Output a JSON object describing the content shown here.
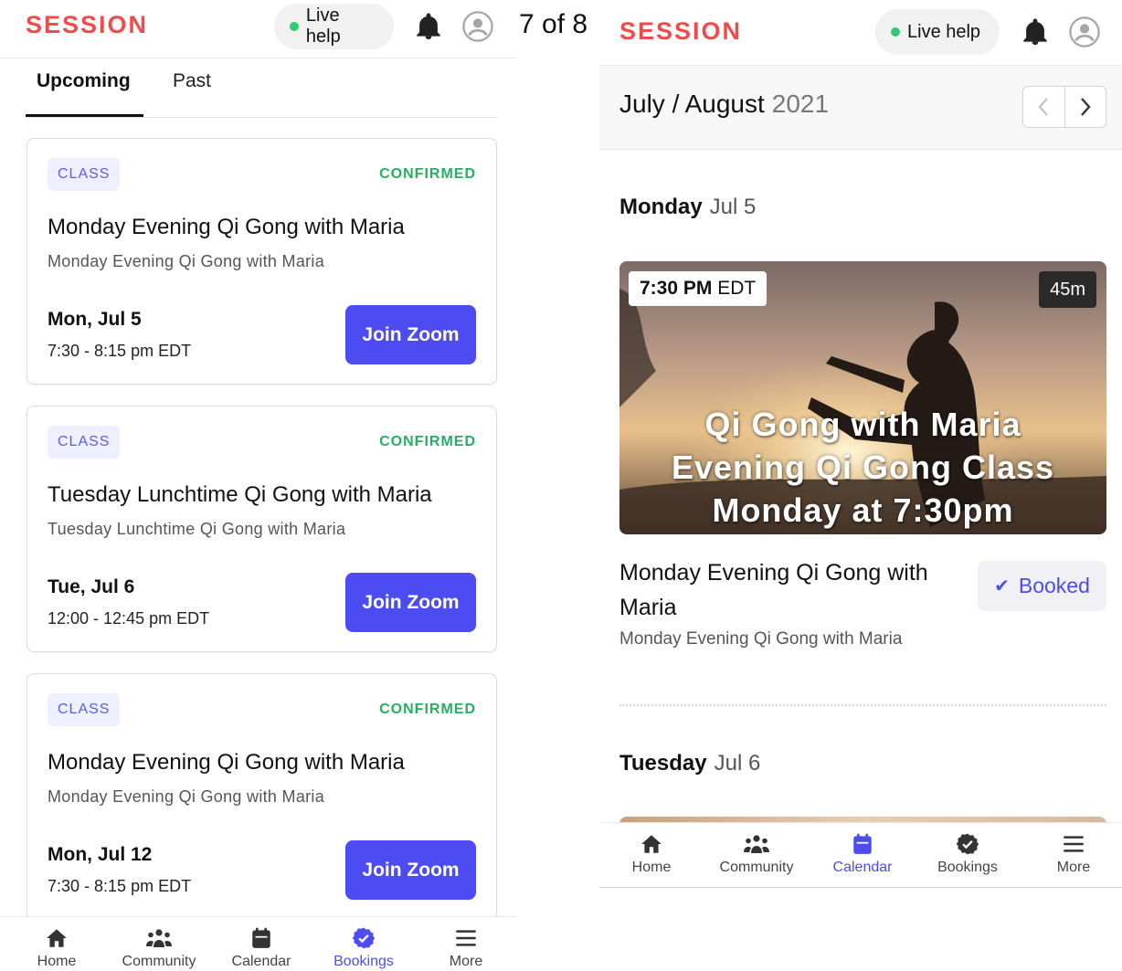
{
  "page_counter": "7 of 8",
  "left": {
    "header": {
      "brand": "SESSION",
      "live_help": "Live help"
    },
    "tabs": [
      {
        "label": "Upcoming"
      },
      {
        "label": "Past"
      }
    ],
    "cards": [
      {
        "badge": "CLASS",
        "status": "CONFIRMED",
        "title": "Monday Evening Qi Gong with Maria",
        "subtitle": "Monday Evening Qi Gong with Maria",
        "date": "Mon, Jul 5",
        "time": "7:30 - 8:15 pm EDT",
        "button": "Join Zoom"
      },
      {
        "badge": "CLASS",
        "status": "CONFIRMED",
        "title": "Tuesday Lunchtime Qi Gong with Maria",
        "subtitle": "Tuesday Lunchtime Qi Gong with Maria",
        "date": "Tue, Jul 6",
        "time": "12:00 - 12:45 pm EDT",
        "button": "Join Zoom"
      },
      {
        "badge": "CLASS",
        "status": "CONFIRMED",
        "title": "Monday Evening Qi Gong with Maria",
        "subtitle": "Monday Evening Qi Gong with Maria",
        "date": "Mon, Jul 12",
        "time": "7:30 - 8:15 pm EDT",
        "button": "Join Zoom"
      }
    ],
    "nav": [
      {
        "label": "Home"
      },
      {
        "label": "Community"
      },
      {
        "label": "Calendar"
      },
      {
        "label": "Bookings"
      },
      {
        "label": "More"
      }
    ]
  },
  "right": {
    "header": {
      "brand": "SESSION",
      "live_help": "Live help"
    },
    "month": {
      "label": "July / August",
      "year": "2021"
    },
    "days": [
      {
        "name": "Monday",
        "date": "Jul 5"
      },
      {
        "name": "Tuesday",
        "date": "Jul 6"
      }
    ],
    "event": {
      "time": "7:30 PM",
      "tz": "EDT",
      "duration": "45m",
      "poster_lines": [
        "Qi Gong with Maria",
        "Evening Qi Gong Class",
        "Monday at 7:30pm"
      ],
      "title": "Monday Evening Qi Gong with Maria",
      "subtitle": "Monday Evening Qi Gong with Maria",
      "booked_label": "Booked"
    },
    "nav": [
      {
        "label": "Home"
      },
      {
        "label": "Community"
      },
      {
        "label": "Calendar"
      },
      {
        "label": "Bookings"
      },
      {
        "label": "More"
      }
    ]
  },
  "colors": {
    "brand": "#ef4b4b",
    "accent": "#4d4cf2",
    "confirmed": "#27ae60",
    "badge_bg": "#eef0ff",
    "online": "#2ecc71"
  },
  "icons": [
    "bell-icon",
    "user-avatar-icon",
    "home-icon",
    "community-icon",
    "calendar-icon",
    "bookings-check-icon",
    "menu-icon",
    "chevron-left-icon",
    "chevron-right-icon",
    "check-icon"
  ],
  "active_nav": {
    "left": "Bookings",
    "right": "Calendar"
  }
}
